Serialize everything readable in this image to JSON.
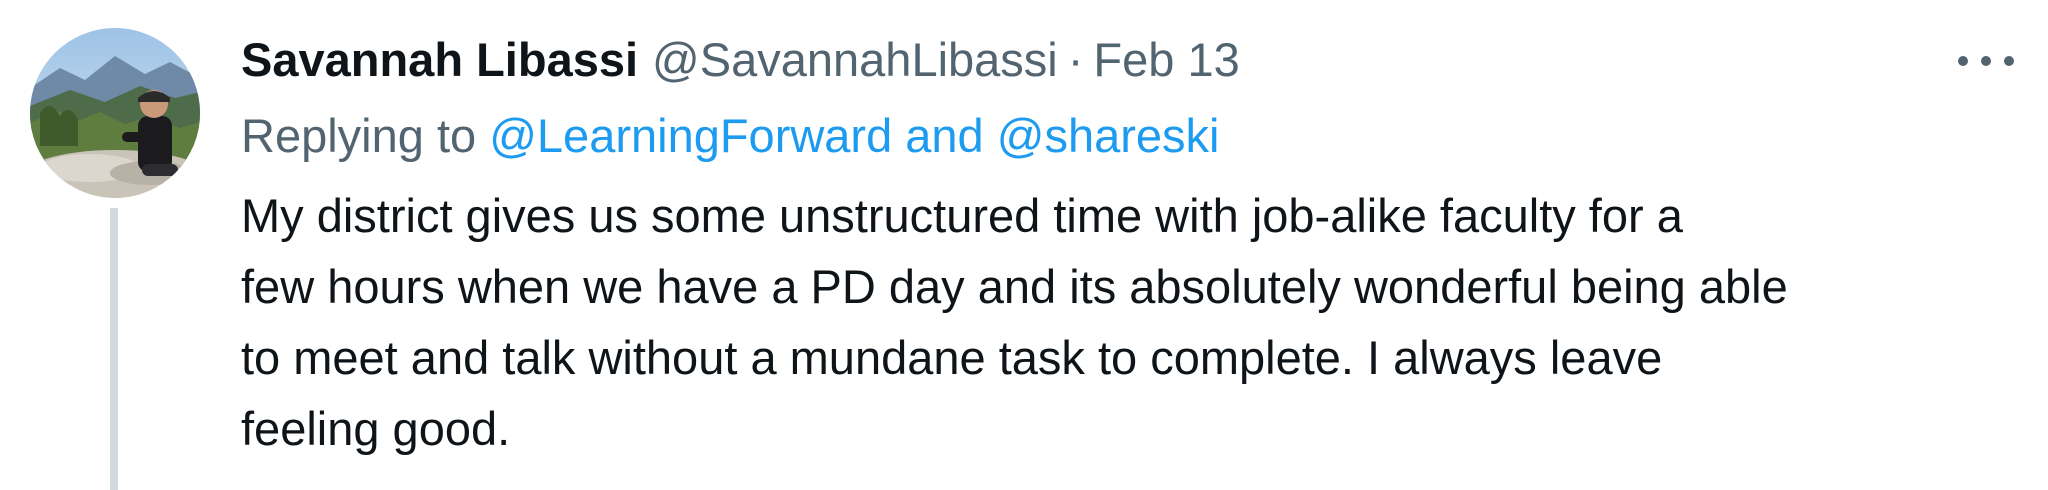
{
  "tweet": {
    "display_name": "Savannah Libassi",
    "handle": "@SavannahLibassi",
    "separator": "·",
    "date": "Feb 13",
    "more_icon": "more-horizontal-icon",
    "replying_to": {
      "prefix": "Replying to",
      "mention_1": "@LearningForward",
      "conjunction": "and",
      "mention_2": "@shareski"
    },
    "body_lines": [
      "My district gives us some unstructured time with job-alike faculty for a",
      "few hours when we have a PD day and its absolutely wonderful being able",
      "to meet and talk without a mundane task to complete. I always leave",
      "feeling good."
    ]
  },
  "colors": {
    "text_primary": "#0f1419",
    "text_secondary": "#536471",
    "link": "#1d9bf0",
    "thread_line": "#cfd9de"
  }
}
